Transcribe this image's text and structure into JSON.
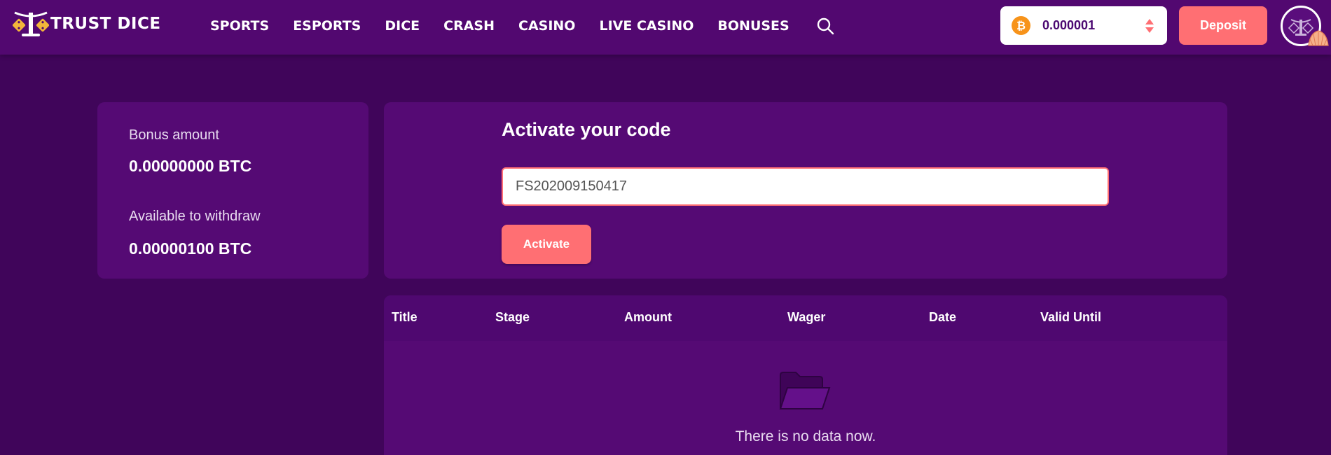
{
  "header": {
    "brand": "TRUST DICE",
    "nav": [
      "SPORTS",
      "ESPORTS",
      "DICE",
      "CRASH",
      "CASINO",
      "LIVE CASINO",
      "BONUSES"
    ],
    "wallet_amount": "0.000001",
    "wallet_currency_icon": "bitcoin-icon",
    "deposit_label": "Deposit"
  },
  "summary": {
    "bonus_label": "Bonus amount",
    "bonus_value": "0.00000000 BTC",
    "withdraw_label": "Available to withdraw",
    "withdraw_value": "0.00000100 BTC"
  },
  "activate": {
    "title": "Activate your code",
    "code_value": "FS202009150417",
    "button_label": "Activate"
  },
  "table": {
    "columns": [
      "Title",
      "Stage",
      "Amount",
      "Wager",
      "Date",
      "Valid Until"
    ],
    "empty_text": "There is no data now."
  },
  "colors": {
    "background": "#40055a",
    "header": "#520870",
    "card": "#550a74",
    "accent": "#ff6f73",
    "bitcoin": "#f7931a"
  }
}
